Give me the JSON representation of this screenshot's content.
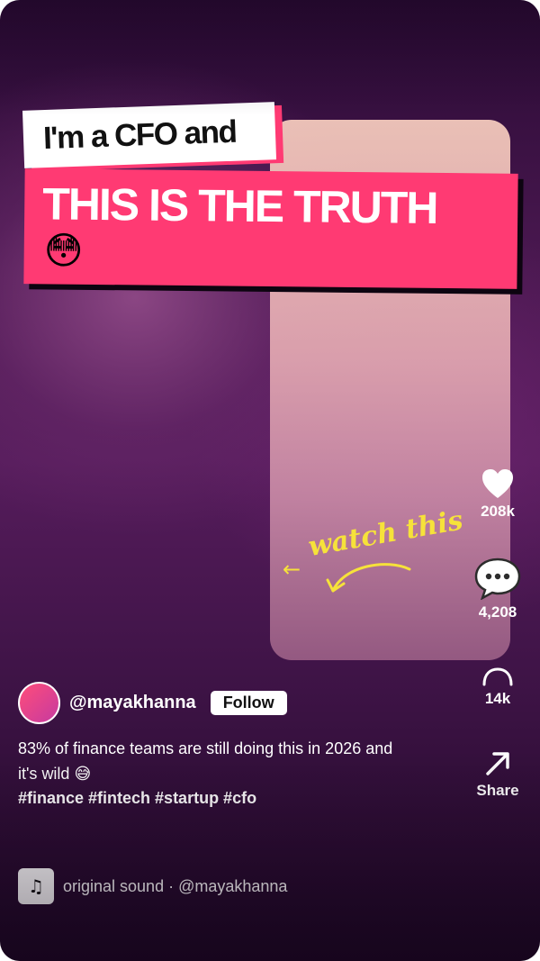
{
  "overlay": {
    "small_banner": "I'm a CFO and",
    "big_banner": "THIS IS THE TRUTH",
    "big_banner_emoji": "😳",
    "annotation_arrow": "←",
    "annotation_text": "watch this"
  },
  "actions": {
    "like_count": "208k",
    "comment_count": "4,208",
    "save_count": "14k",
    "share_label": "Share"
  },
  "creator": {
    "username": "@mayakhanna",
    "follow_label": "Follow"
  },
  "caption": {
    "text": "83% of finance teams are still doing this in 2026 and it's wild 😅",
    "hashtags": "#finance #fintech #startup #cfo"
  },
  "sound": {
    "icon": "♫",
    "label": "original sound · @mayakhanna"
  },
  "colors": {
    "accent": "#ff3a73",
    "annotation": "#f6e23a",
    "background_top": "#2a0a35",
    "background_mid": "#561c5c"
  },
  "icons": {
    "like": "heart-icon",
    "comment": "comment-bubble-icon",
    "save": "bookmark-icon",
    "share": "share-arrow-icon",
    "sound": "music-note-icon"
  }
}
